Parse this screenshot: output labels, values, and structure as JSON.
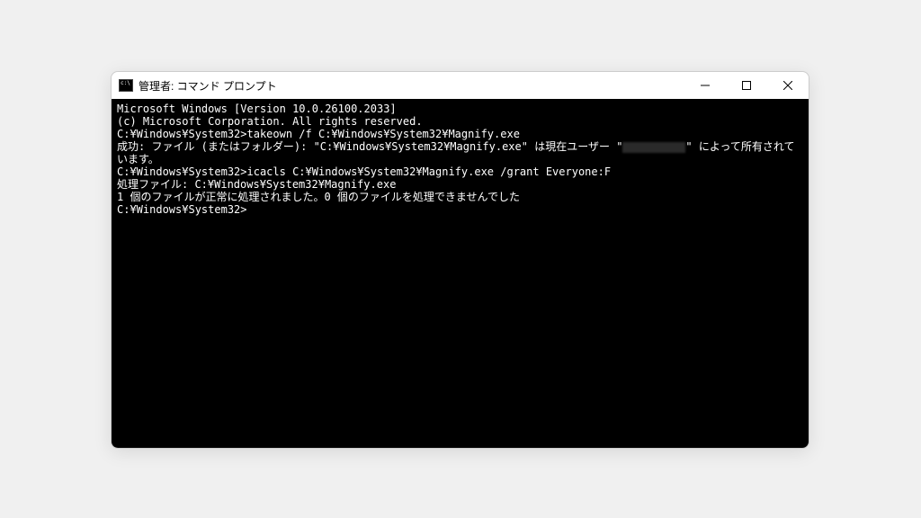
{
  "window": {
    "title": "管理者: コマンド プロンプト"
  },
  "terminal": {
    "lines": {
      "l0": "Microsoft Windows [Version 10.0.26100.2033]",
      "l1": "(c) Microsoft Corporation. All rights reserved.",
      "l2": "",
      "l3": "C:¥Windows¥System32>takeown /f C:¥Windows¥System32¥Magnify.exe",
      "l4": "",
      "l5a": "成功: ファイル (またはフォルダー): \"C:¥Windows¥System32¥Magnify.exe\" は現在ユーザー \"",
      "l5b": "\" によって所有されています。",
      "l6": "",
      "l7": "C:¥Windows¥System32>icacls C:¥Windows¥System32¥Magnify.exe /grant Everyone:F",
      "l8": "処理ファイル: C:¥Windows¥System32¥Magnify.exe",
      "l9": "1 個のファイルが正常に処理されました。0 個のファイルを処理できませんでした",
      "l10": "",
      "l11": "C:¥Windows¥System32>"
    }
  }
}
